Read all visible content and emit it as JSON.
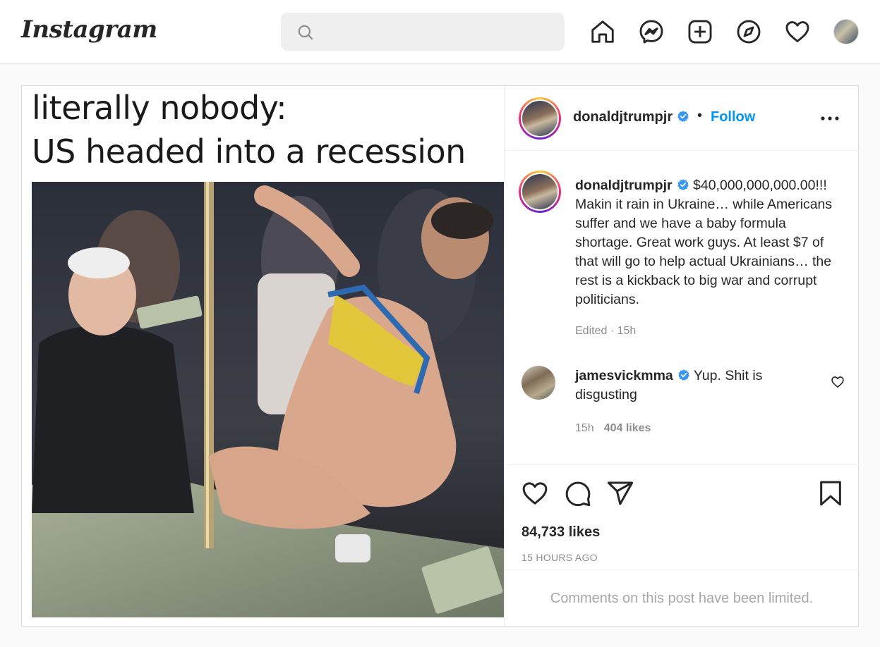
{
  "app": {
    "logo_text": "Instagram"
  },
  "search": {
    "placeholder": "",
    "value": ""
  },
  "nav": {
    "icons": [
      "home-icon",
      "messenger-icon",
      "new-post-icon",
      "explore-icon",
      "activity-heart-icon",
      "profile-avatar"
    ]
  },
  "post": {
    "meme": {
      "line1": "literally nobody:",
      "line2": "US headed into a recession"
    },
    "header": {
      "username": "donaldjtrumpjr",
      "separator": "•",
      "follow_label": "Follow"
    },
    "caption": {
      "username": "donaldjtrumpjr",
      "text": "$40,000,000,000.00!!! Makin it rain in Ukraine… while Americans suffer and we have a baby formula shortage. Great work guys. At least $7 of that will go to help actual Ukrainians… the rest is a kickback to big war and corrupt politicians.",
      "edited": "Edited · 15h"
    },
    "comment": {
      "username": "jamesvickmma",
      "text": "Yup. Shit is disgusting",
      "age": "15h",
      "likes": "404 likes"
    },
    "likes": "84,733 likes",
    "timestamp": "15 HOURS AGO",
    "comments_limited": "Comments on this post have been limited."
  },
  "colors": {
    "link_blue": "#0095f6",
    "verified_blue": "#3897f0",
    "muted": "#8e8e8e",
    "border": "#dbdbdb"
  }
}
